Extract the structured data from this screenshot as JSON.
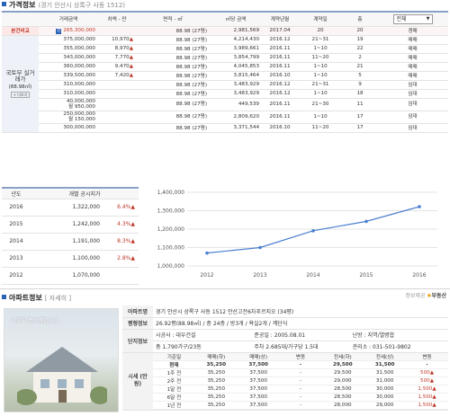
{
  "price_section": {
    "title": "가격정보",
    "subtitle": "(경기 안산시 상록구 사동 1512)",
    "headers": [
      "거래금액",
      "차액 - 만",
      "면적 - ㎡",
      "㎡당 금액",
      "계약년월",
      "계약일",
      "층"
    ],
    "filter": "전체",
    "base_row": {
      "label": "본건비교",
      "badge": "감",
      "price": "265,300,000",
      "area": "88.98 (27평)",
      "per_m2": "2,981,569",
      "ym": "2017.04",
      "day": "20",
      "floor": "20",
      "type": "경매"
    },
    "group_label": "국토부 실거래가",
    "group_sub": "(88.98㎡)",
    "group_btn": "+ 더보기",
    "rows": [
      {
        "price": "375,000,000",
        "diff": "10,970",
        "area": "88.98 (27평)",
        "per_m2": "4,214,430",
        "ym": "2016.12",
        "day": "21~31",
        "floor": "19",
        "type": "매매"
      },
      {
        "price": "355,000,000",
        "diff": "8,970",
        "area": "88.98 (27평)",
        "per_m2": "3,989,661",
        "ym": "2016.11",
        "day": "1~10",
        "floor": "22",
        "type": "매매"
      },
      {
        "price": "343,000,000",
        "diff": "7,770",
        "area": "88.98 (27평)",
        "per_m2": "3,854,799",
        "ym": "2016.11",
        "day": "11~20",
        "floor": "2",
        "type": "매매"
      },
      {
        "price": "360,000,000",
        "diff": "9,470",
        "area": "88.98 (27평)",
        "per_m2": "4,045,853",
        "ym": "2016.11",
        "day": "1~10",
        "floor": "21",
        "type": "매매"
      },
      {
        "price": "339,500,000",
        "diff": "7,420",
        "area": "88.98 (27평)",
        "per_m2": "3,815,464",
        "ym": "2016.10",
        "day": "1~10",
        "floor": "5",
        "type": "매매"
      },
      {
        "price": "310,000,000",
        "diff": "",
        "area": "88.98 (27평)",
        "per_m2": "3,483,929",
        "ym": "2016.12",
        "day": "21~31",
        "floor": "9",
        "type": "임대"
      },
      {
        "price": "310,000,000",
        "diff": "",
        "area": "88.98 (27평)",
        "per_m2": "3,483,929",
        "ym": "2016.12",
        "day": "1~10",
        "floor": "18",
        "type": "임대"
      },
      {
        "price": "40,000,000",
        "price2": "월 950,000",
        "diff": "",
        "area": "88.98 (27평)",
        "per_m2": "449,539",
        "ym": "2016.11",
        "day": "21~30",
        "floor": "11",
        "type": "임대"
      },
      {
        "price": "250,000,000",
        "price2": "월 150,000",
        "diff": "",
        "area": "88.98 (27평)",
        "per_m2": "2,809,620",
        "ym": "2016.11",
        "day": "1~10",
        "floor": "17",
        "type": "임대"
      },
      {
        "price": "300,000,000",
        "diff": "",
        "area": "88.98 (27평)",
        "per_m2": "3,371,544",
        "ym": "2016.10",
        "day": "11~20",
        "floor": "17",
        "type": "임대"
      }
    ]
  },
  "gongsi": {
    "headers": [
      "년도",
      "개별 공시지가"
    ],
    "rows": [
      {
        "year": "2016",
        "value": "1,322,000",
        "pct": "6.4%"
      },
      {
        "year": "2015",
        "value": "1,242,000",
        "pct": "4.3%"
      },
      {
        "year": "2014",
        "value": "1,191,000",
        "pct": "8.3%"
      },
      {
        "year": "2013",
        "value": "1,100,000",
        "pct": "2.8%"
      },
      {
        "year": "2012",
        "value": "1,070,000",
        "pct": ""
      }
    ]
  },
  "chart_data": {
    "type": "line",
    "x": [
      "2012",
      "2013",
      "2014",
      "2015",
      "2016"
    ],
    "series": [
      {
        "values": [
          1070000,
          1100000,
          1191000,
          1242000,
          1322000
        ]
      }
    ],
    "yticks": [
      "1,000,000",
      "1,100,000",
      "1,200,000",
      "1,300,000",
      "1,400,000"
    ],
    "ylim": [
      1000000,
      1400000
    ],
    "grid": true,
    "line_color": "#4a7fd0"
  },
  "source_text": "정보제공",
  "source_logo": "부동산",
  "apt_section": {
    "title": "아파트정보",
    "link": "[ 자세히 ]",
    "photo_caption": "이미지 준비중입니다.",
    "name_label": "아파트명",
    "name_value": "경기 안산시 상록구 사동 1512 안산고잔6차푸르지오 (34평)",
    "floor_label": "평형정보",
    "floor_value": "26.92평(88.98㎡) / 층 24층 / 방3개 / 욕실2개 / 계단식",
    "complex_label": "단지정보",
    "builder": "시공사 : 대우건설",
    "completed": "준공일 : 2005.08.01",
    "heating": "난방 : 지역/열병합",
    "households": "총 1,790가구/23동",
    "parking": "주차 2.685대/가구당 1.5대",
    "office": "관리소 : 031-501-9802",
    "market_label": "시세 (만원)",
    "market_headers": [
      "기준일",
      "매매(하)",
      "매매(상)",
      "변동",
      "전세(하)",
      "전세(상)",
      "변동"
    ],
    "market_rows": [
      [
        "현재",
        "35,250",
        "37,500",
        "-",
        "29,500",
        "31,500",
        "-"
      ],
      [
        "1주 전",
        "35,250",
        "37,500",
        "-",
        "29,500",
        "31,500",
        "500"
      ],
      [
        "2주 전",
        "35,250",
        "37,500",
        "-",
        "29,000",
        "31,000",
        "500"
      ],
      [
        "1달 전",
        "35,250",
        "37,500",
        "-",
        "28,500",
        "30,000",
        "1,500"
      ],
      [
        "6달 전",
        "35,250",
        "37,500",
        "-",
        "28,500",
        "30,000",
        "1,500"
      ],
      [
        "1년 전",
        "35,250",
        "37,500",
        "-",
        "28,000",
        "29,000",
        "1,500"
      ]
    ]
  }
}
